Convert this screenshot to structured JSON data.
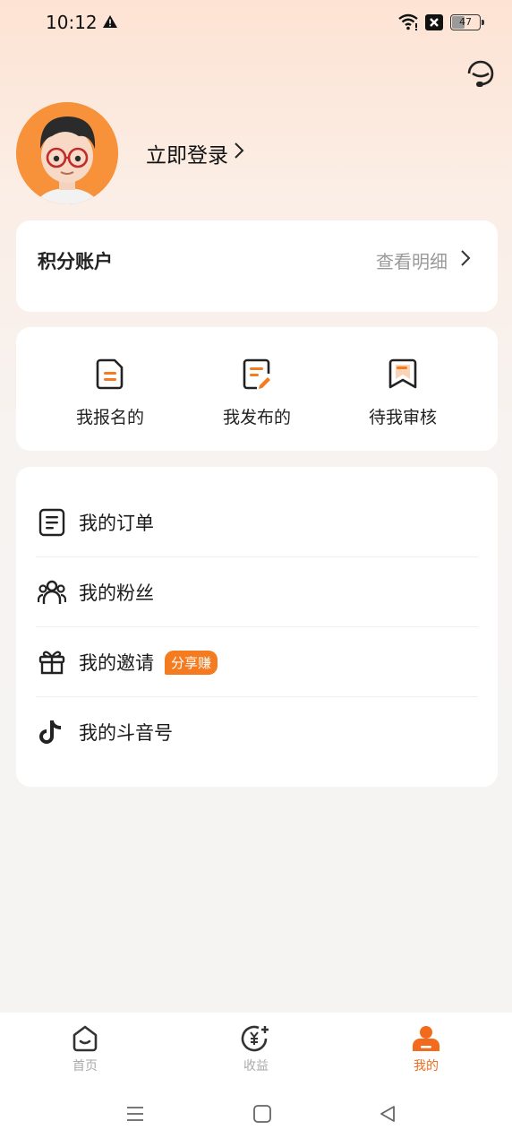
{
  "status_bar": {
    "time": "10:12",
    "battery": "47",
    "battery_level": 0.47,
    "icons": [
      "warning-icon",
      "wifi-icon",
      "x-box-icon",
      "battery-icon"
    ]
  },
  "header": {
    "service_icon": "customer-service-icon",
    "login_label": "立即登录"
  },
  "points": {
    "title": "积分账户",
    "detail_label": "查看明细"
  },
  "actions": [
    {
      "label": "我报名的",
      "icon": "signup-doc-icon"
    },
    {
      "label": "我发布的",
      "icon": "publish-doc-icon"
    },
    {
      "label": "待我审核",
      "icon": "review-bookmark-icon"
    }
  ],
  "menu": [
    {
      "label": "我的订单",
      "icon": "order-list-icon"
    },
    {
      "label": "我的粉丝",
      "icon": "fans-icon"
    },
    {
      "label": "我的邀请",
      "icon": "gift-icon",
      "badge": "分享赚"
    },
    {
      "label": "我的斗音号",
      "icon": "douyin-icon"
    }
  ],
  "tabbar": [
    {
      "label": "首页",
      "icon": "home-icon",
      "active": false
    },
    {
      "label": "收益",
      "icon": "earnings-icon",
      "active": false
    },
    {
      "label": "我的",
      "icon": "profile-icon",
      "active": true
    }
  ],
  "colors": {
    "accent": "#f26b1d",
    "badge": "#f47b20",
    "muted_text": "#9a9a9a"
  }
}
